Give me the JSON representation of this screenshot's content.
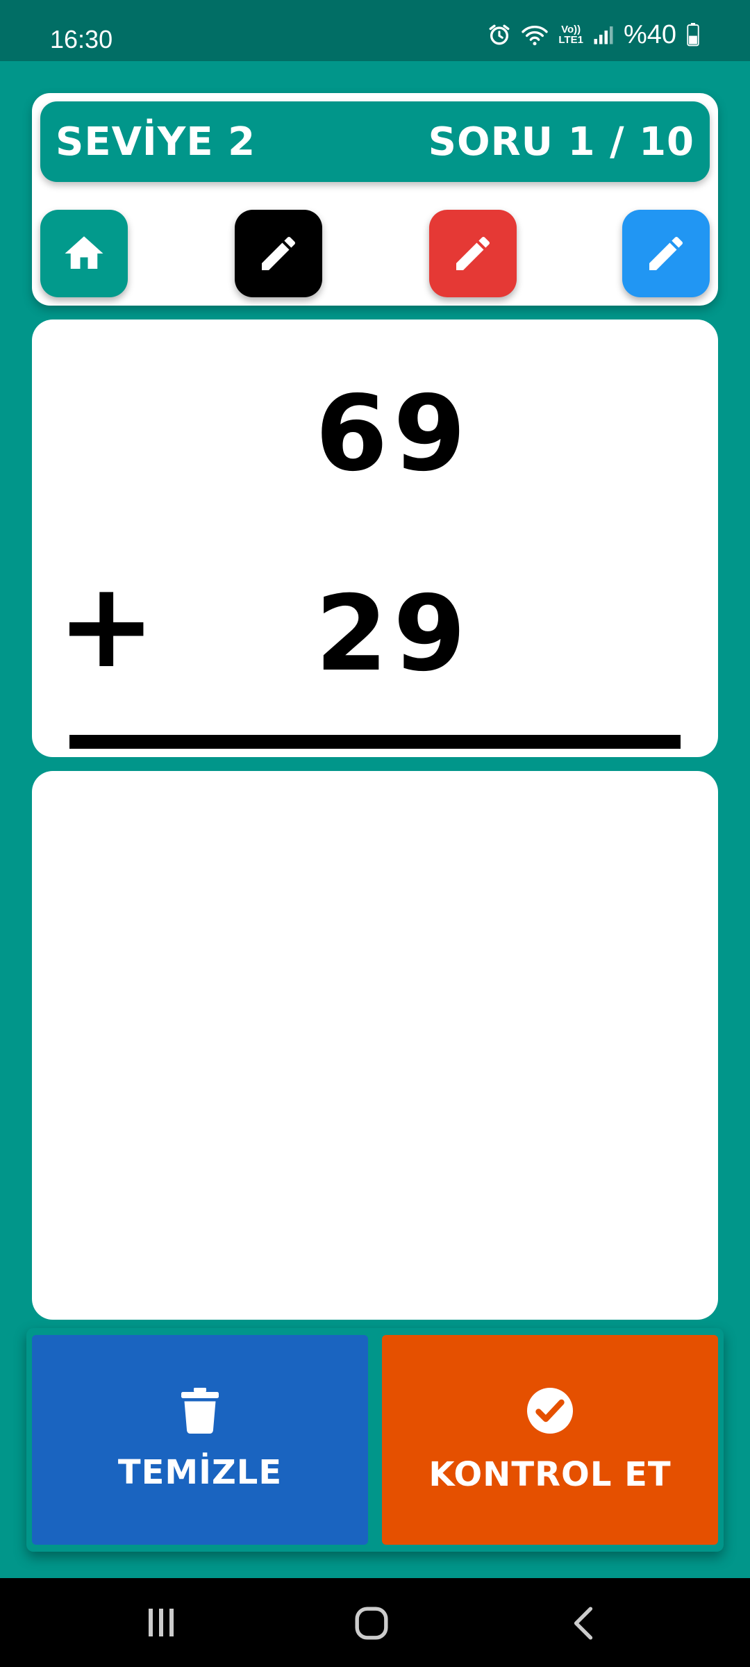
{
  "status_bar": {
    "time": "16:30",
    "volte": "Vo))",
    "lte": "LTE1",
    "battery": "%40"
  },
  "header": {
    "level": "SEVİYE 2",
    "question_counter": "SORU  1 / 10"
  },
  "toolbar": {
    "home_icon": "home-icon",
    "pens": [
      {
        "name": "pencil-icon",
        "color": "#000000"
      },
      {
        "name": "pencil-icon",
        "color": "#e53935"
      },
      {
        "name": "pencil-icon",
        "color": "#2196f3"
      }
    ]
  },
  "problem": {
    "top_number": "69",
    "bottom_number": "29",
    "operator": "+"
  },
  "actions": {
    "clear_label": "TEMİZLE",
    "clear_icon": "trash-icon",
    "check_label": "KONTROL ET",
    "check_icon": "check-circle-icon"
  },
  "colors": {
    "background": "#01968a",
    "status_bar": "#016e65",
    "clear_button": "#1a64c0",
    "check_button": "#e55000"
  }
}
